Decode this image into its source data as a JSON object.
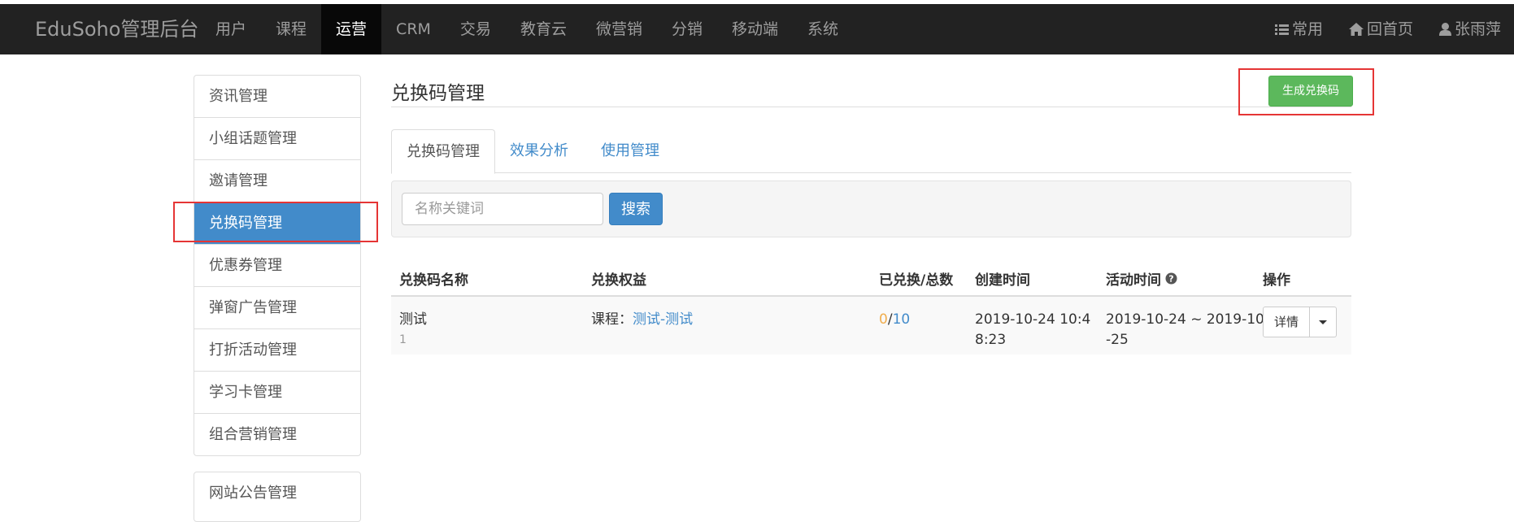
{
  "brand": "EduSoho管理后台",
  "nav": {
    "items": [
      {
        "label": "用户"
      },
      {
        "label": "课程"
      },
      {
        "label": "运营",
        "active": true
      },
      {
        "label": "CRM"
      },
      {
        "label": "交易"
      },
      {
        "label": "教育云"
      },
      {
        "label": "微营销"
      },
      {
        "label": "分销"
      },
      {
        "label": "移动端"
      },
      {
        "label": "系统"
      }
    ],
    "right": {
      "frequent": "常用",
      "home": "回首页",
      "user": "张雨萍"
    }
  },
  "sidebar": {
    "items": [
      {
        "label": "资讯管理"
      },
      {
        "label": "小组话题管理"
      },
      {
        "label": "邀请管理"
      },
      {
        "label": "兑换码管理",
        "active": true
      },
      {
        "label": "优惠券管理"
      },
      {
        "label": "弹窗广告管理"
      },
      {
        "label": "打折活动管理"
      },
      {
        "label": "学习卡管理"
      },
      {
        "label": "组合营销管理"
      }
    ],
    "secondary": {
      "label": "网站公告管理"
    }
  },
  "main": {
    "title": "兑换码管理",
    "generate_button": "生成兑换码",
    "tabs": [
      {
        "label": "兑换码管理",
        "active": true
      },
      {
        "label": "效果分析"
      },
      {
        "label": "使用管理"
      }
    ],
    "search": {
      "placeholder": "名称关键词",
      "button": "搜索"
    },
    "table": {
      "headers": {
        "name": "兑换码名称",
        "benefit": "兑换权益",
        "redeemed": "已兑换/总数",
        "created": "创建时间",
        "period": "活动时间",
        "action": "操作"
      },
      "rows": [
        {
          "name": "测试",
          "sub": "1",
          "benefit_prefix": "课程：",
          "benefit_link": "测试-测试",
          "redeemed": "0",
          "separator": "/",
          "total": "10",
          "created_line1": "2019-10-24 10:4",
          "created_line2": "8:23",
          "period_line1": "2019-10-24 ~ 2019-10",
          "period_line2": "-25",
          "detail_button": "详情"
        }
      ]
    }
  },
  "colors": {
    "navbar": "#222222",
    "active_blue": "#428bca",
    "success_green": "#5cb85c",
    "highlight_red": "#e53535",
    "warning_orange": "#f0ad4e"
  }
}
